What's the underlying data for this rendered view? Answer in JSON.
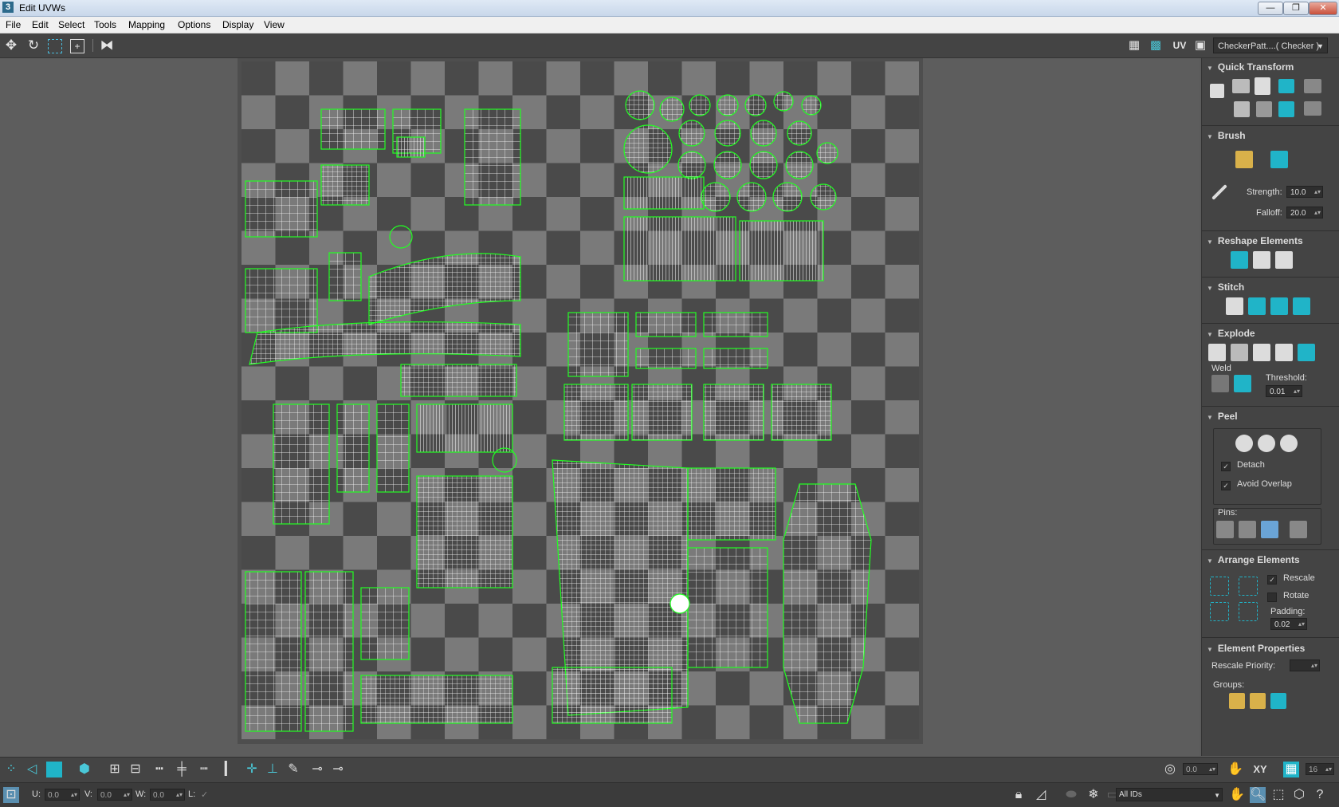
{
  "window": {
    "title": "Edit UVWs",
    "app_icon": "3",
    "controls": [
      "—",
      "❐",
      "✕"
    ]
  },
  "menu": [
    "File",
    "Edit",
    "Select",
    "Tools",
    "Mapping",
    "Options",
    "Display",
    "View"
  ],
  "toolbar": {
    "left_icons": [
      "move-icon",
      "rotate-icon",
      "scale-icon",
      "freeform-icon",
      "mirror-icon"
    ],
    "uv_label": "UV",
    "checker_select": "CheckerPatt....( Checker )"
  },
  "panel": {
    "quick_transform": {
      "title": "Quick Transform"
    },
    "brush": {
      "title": "Brush",
      "strength_label": "Strength:",
      "strength_value": "10.0",
      "falloff_label": "Falloff:",
      "falloff_value": "20.0"
    },
    "reshape": {
      "title": "Reshape Elements"
    },
    "stitch": {
      "title": "Stitch"
    },
    "explode": {
      "title": "Explode",
      "weld_label": "Weld",
      "threshold_label": "Threshold:",
      "threshold_value": "0.01"
    },
    "peel": {
      "title": "Peel",
      "detach_label": "Detach",
      "avoid_overlap_label": "Avoid Overlap",
      "pins_label": "Pins:",
      "detach_checked": true,
      "avoid_overlap_checked": true
    },
    "arrange": {
      "title": "Arrange Elements",
      "rescale_label": "Rescale",
      "rotate_label": "Rotate",
      "padding_label": "Padding:",
      "padding_value": "0.02",
      "rescale_checked": true,
      "rotate_checked": false
    },
    "element_props": {
      "title": "Element Properties",
      "rescale_priority_label": "Rescale Priority:",
      "groups_label": "Groups:"
    }
  },
  "bottom": {
    "angle_value": "0.0",
    "xy_label": "XY",
    "grid_value": "16",
    "u_label": "U:",
    "u_value": "0.0",
    "v_label": "V:",
    "v_value": "0.0",
    "w_label": "W:",
    "w_value": "0.0",
    "l_label": "L:",
    "ids_select": "All IDs"
  },
  "colors": {
    "uv_edge": "#22ff22",
    "uv_line": "#ffffff",
    "checker_dark": "#4a4a4a",
    "checker_light": "#7a7a7a",
    "accent": "#20b4c8"
  }
}
